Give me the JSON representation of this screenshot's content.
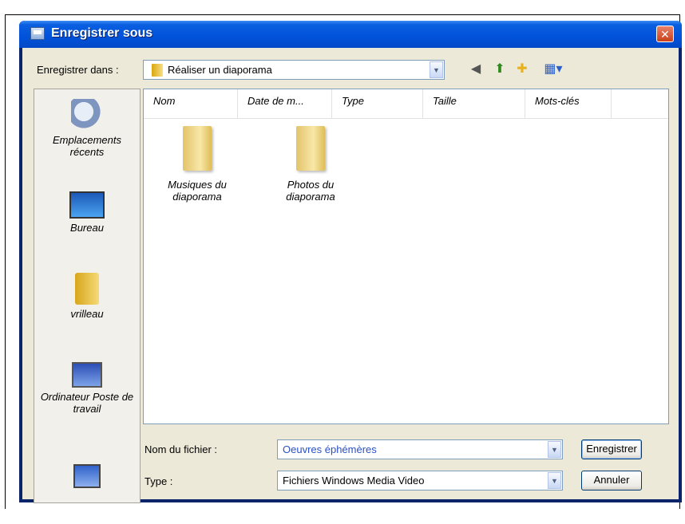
{
  "window": {
    "title": "Enregistrer sous",
    "close_glyph": "✕"
  },
  "save_in": {
    "label": "Enregistrer dans :",
    "value": "Réaliser un diaporama"
  },
  "toolbar": {
    "back": "◀",
    "up": "⬆",
    "new_folder": "✚",
    "views": "▦▾"
  },
  "places": [
    {
      "name": "recent-places",
      "label": "Emplacements récents",
      "icon": "recent-icon"
    },
    {
      "name": "desktop",
      "label": "Bureau",
      "icon": "desktop-icon"
    },
    {
      "name": "user",
      "label": "vrilleau",
      "icon": "user-folder-icon"
    },
    {
      "name": "computer",
      "label": "Ordinateur Poste de travail",
      "icon": "computer-icon"
    },
    {
      "name": "network",
      "label": "",
      "icon": "network-icon"
    }
  ],
  "columns": [
    "Nom",
    "Date de m...",
    "Type",
    "Taille",
    "Mots-clés"
  ],
  "files": [
    {
      "label": "Musiques du diaporama",
      "icon": "folder-icon"
    },
    {
      "label": "Photos du diaporama",
      "icon": "folder-icon"
    }
  ],
  "filename": {
    "label": "Nom du fichier :",
    "value": "Oeuvres éphémères"
  },
  "filetype": {
    "label": "Type :",
    "value": "Fichiers Windows Media Video"
  },
  "buttons": {
    "save": "Enregistrer",
    "cancel": "Annuler"
  },
  "dropdown_glyph": "▼"
}
